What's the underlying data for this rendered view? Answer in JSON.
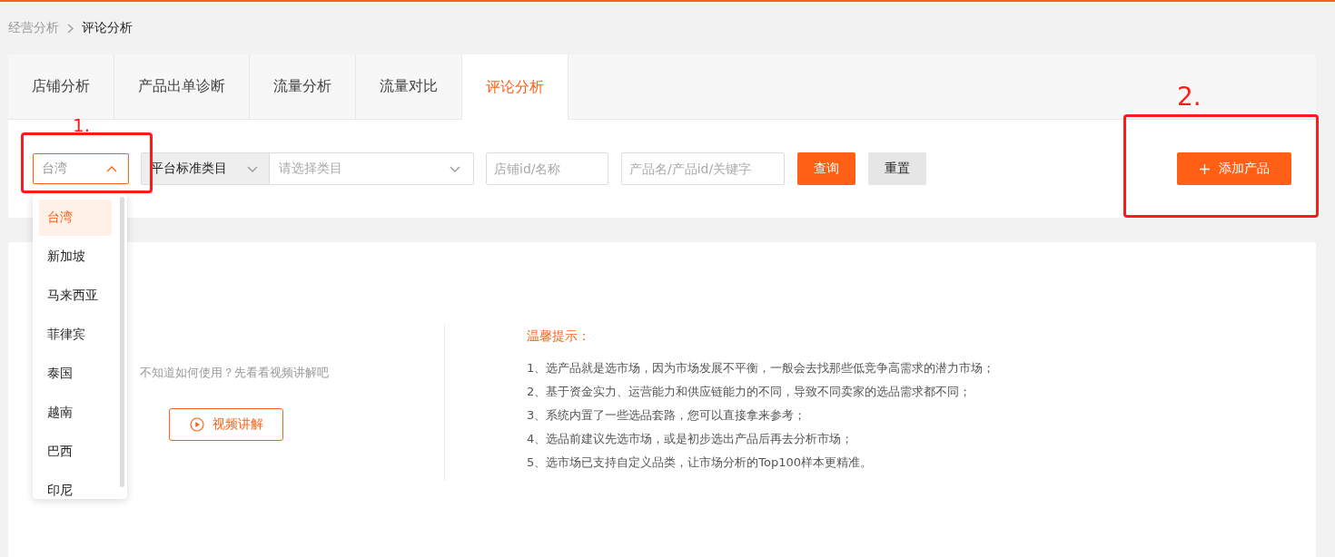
{
  "breadcrumb": [
    {
      "label": "经营分析",
      "current": false
    },
    {
      "label": "评论分析",
      "current": true
    }
  ],
  "tabs": [
    {
      "label": "店铺分析",
      "selected": false
    },
    {
      "label": "产品出单诊断",
      "selected": false
    },
    {
      "label": "流量分析",
      "selected": false
    },
    {
      "label": "流量对比",
      "selected": false
    },
    {
      "label": "评论分析",
      "selected": true
    }
  ],
  "filters": {
    "region": {
      "value": "台湾",
      "expanded": true,
      "options": [
        {
          "label": "台湾",
          "selected": true
        },
        {
          "label": "新加坡",
          "selected": false
        },
        {
          "label": "马来西亚",
          "selected": false
        },
        {
          "label": "菲律宾",
          "selected": false
        },
        {
          "label": "泰国",
          "selected": false
        },
        {
          "label": "越南",
          "selected": false
        },
        {
          "label": "巴西",
          "selected": false
        },
        {
          "label": "印尼",
          "selected": false
        }
      ]
    },
    "category": {
      "type": "平台标准类目",
      "placeholder": "请选择类目"
    },
    "store": {
      "placeholder": "店铺id/名称"
    },
    "product": {
      "placeholder": "产品名/产品id/关键字"
    },
    "buttons": [
      {
        "label": "查询",
        "kind": "primary"
      },
      {
        "label": "重置",
        "kind": "default"
      }
    ]
  },
  "add_button": {
    "label": "添加产品"
  },
  "help": {
    "text": "不知道如何使用？先看看视频讲解吧",
    "video_button": "视频讲解"
  },
  "tips": {
    "title": "温馨提示：",
    "items": [
      "1、选产品就是选市场，因为市场发展不平衡，一般会去找那些低竞争高需求的潜力市场；",
      "2、基于资金实力、运营能力和供应链能力的不同，导致不同卖家的选品需求都不同；",
      "3、系统内置了一些选品套路，您可以直接拿来参考；",
      "4、选品前建议先选市场，或是初步选出产品后再去分析市场；",
      "5、选市场已支持自定义品类，让市场分析的Top100样本更精准。"
    ]
  },
  "annotations": [
    {
      "label": "1."
    },
    {
      "label": "2."
    }
  ]
}
